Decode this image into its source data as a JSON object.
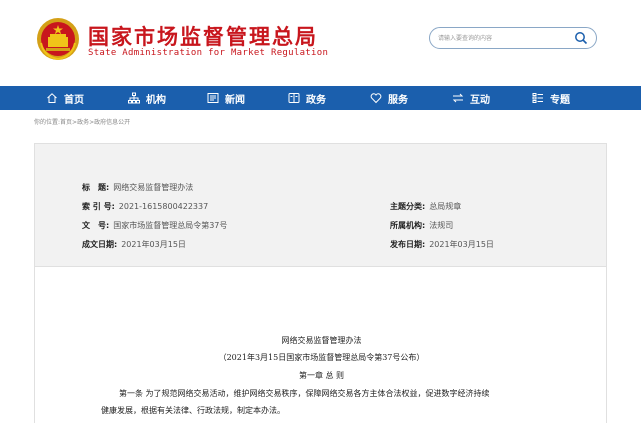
{
  "header": {
    "title_zh": "国家市场监督管理总局",
    "title_en": "State Administration for Market Regulation",
    "search_placeholder": "请输入要查询的内容",
    "brand_color": "#c8161d"
  },
  "nav": {
    "background": "#1b5fad",
    "items": [
      {
        "label": "首页",
        "icon": "home-icon"
      },
      {
        "label": "机构",
        "icon": "org-chart-icon"
      },
      {
        "label": "新闻",
        "icon": "news-icon"
      },
      {
        "label": "政务",
        "icon": "government-affairs-icon"
      },
      {
        "label": "服务",
        "icon": "heart-icon"
      },
      {
        "label": "互动",
        "icon": "exchange-arrows-icon"
      },
      {
        "label": "专题",
        "icon": "topics-icon"
      }
    ]
  },
  "breadcrumb": {
    "prefix": "你的位置:",
    "items": [
      "首页",
      "政务",
      "政府信息公开"
    ],
    "separator": ">"
  },
  "info": {
    "title_label": "标　题:",
    "title_value": "网络交易监督管理办法",
    "index_label": "索 引 号:",
    "index_value": "2021-1615800422337",
    "docno_label": "文　号:",
    "docno_value": "国家市场监督管理总局令第37号",
    "date_label": "成文日期:",
    "date_value": "2021年03月15日",
    "category_label": "主题分类:",
    "category_value": "总局规章",
    "org_label": "所属机构:",
    "org_value": "法规司",
    "publish_label": "发布日期:",
    "publish_value": "2021年03月15日"
  },
  "doc": {
    "title": "网络交易监督管理办法",
    "subtitle": "（2021年3月15日国家市场监督管理总局令第37号公布）",
    "chapter": "第一章 总 则",
    "article1_line1": "第一条 为了规范网络交易活动，维护网络交易秩序，保障网络交易各方主体合法权益，促进数字经济持续",
    "article1_line2": "健康发展，根据有关法律、行政法规，制定本办法。"
  }
}
